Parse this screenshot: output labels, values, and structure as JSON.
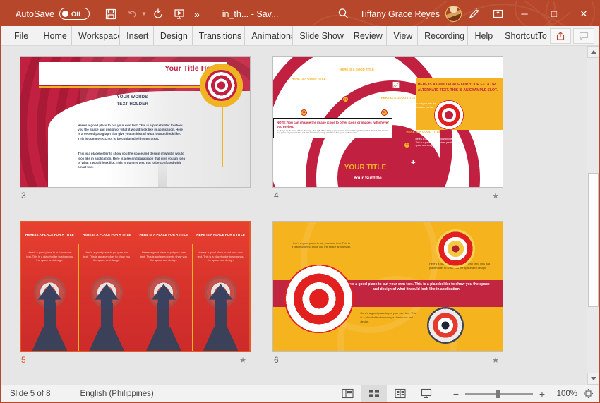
{
  "titlebar": {
    "autosave_label": "AutoSave",
    "autosave_state": "Off",
    "quick_access": [
      {
        "name": "save-button",
        "label": "Save"
      },
      {
        "name": "undo-button",
        "label": "Undo"
      },
      {
        "name": "redo-button",
        "label": "Redo"
      },
      {
        "name": "start-presentation-button",
        "label": "Start From Beginning"
      },
      {
        "name": "more-commands-button",
        "label": "»"
      }
    ],
    "document_title": "in_th...  -  Sav...",
    "search_placeholder": "Search",
    "user_name": "Tiffany Grace Reyes",
    "ribbon_display_label": "Ribbon Display Options",
    "minimize_label": "─",
    "maximize_label": "□",
    "close_label": "✕"
  },
  "ribbon": {
    "tabs": [
      {
        "label": "File"
      },
      {
        "label": "Home"
      },
      {
        "label": "Workspace"
      },
      {
        "label": "Insert"
      },
      {
        "label": "Design"
      },
      {
        "label": "Transitions"
      },
      {
        "label": "Animations"
      },
      {
        "label": "Slide Show"
      },
      {
        "label": "Review"
      },
      {
        "label": "View"
      },
      {
        "label": "Recording"
      },
      {
        "label": "Help"
      },
      {
        "label": "ShortcutTo"
      }
    ],
    "share_label": "Share",
    "comments_label": "Comments"
  },
  "slides": [
    {
      "number": "3",
      "has_animation_star": false,
      "selected": false,
      "title": "Your Title Here",
      "subtitle_line1": "YOUR WORDS",
      "subtitle_line2": "TEXT HOLDER",
      "paragraph1": "Here's a good place to put your own text. This is a placeholder to show you the space and design of what it would look like in application. Here is a second paragraph that give you an idea of what it would look like. This is dummy text, not to be confused with smart text.",
      "paragraph2": "This is a placeholder to show you the space and design of what it would look like in application. Here is a second paragraph that give you an idea of what it would look like. This is dummy text, not to be confused with smart text."
    },
    {
      "number": "4",
      "has_animation_star": true,
      "selected": false,
      "main_title": "YOUR TITLE",
      "subtitle": "Your Subtitle",
      "yellow_box_text": "HERE IS A GOOD PLACE FOR YOUR  EXTA OR ALTERNATE TEXT. THIS IS AN EXAMPLE SLOT.",
      "note_heading": "NOTE: You can change the image icons to other icons or images (whichever you prefer).",
      "note_body": "To change out the icons, click on the image, then right click to bring up popup menu. Choose \"Change Picture\" then \"From a File\". Locate your picture on your hard drive and click \"Insert\". Your image should now be in place of the last icon.",
      "steps": [
        {
          "badge": "01",
          "title": "HERE IS A GOOD TITLE",
          "text": "Here's a good place to put your own text. This is a placeholder to show you the space and design.",
          "icon": "gear-icon"
        },
        {
          "badge": "02",
          "title": "HERE IS A GOOD TITLE",
          "text": "Here's a good place to put your own text. This is a placeholder to show you the space and design.",
          "icon": "phone-icon"
        },
        {
          "badge": "03",
          "title": "HERE IS A GOOD TITLE",
          "text": "Here's a good place to put your own text. This is a placeholder to show you the space and design.",
          "icon": "chart-icon"
        },
        {
          "badge": "04",
          "title": "HERE IS A GOOD TITLE",
          "text": "Here's a good place to put your own text. This is a placeholder to show you the space and design.",
          "icon": "puzzle-icon"
        }
      ]
    },
    {
      "number": "5",
      "has_animation_star": true,
      "selected": true,
      "columns": [
        {
          "title": "HERE IS A PLACE FOR A TITLE",
          "text": "Here's a good place to put your own text. This is a placeholder to show you the space and design."
        },
        {
          "title": "HERE IS A PLACE FOR A TITLE",
          "text": "Here's a good place to put your own text. This is a placeholder to show you the space and design."
        },
        {
          "title": "HERE IS A PLACE FOR A TITLE",
          "text": "Here's a good place to put your own text. This is a placeholder to show you the space and design."
        },
        {
          "title": "HERE IS A PLACE FOR A TITLE",
          "text": "Here's a good place to put your own text. This is a placeholder to show you the space and design."
        }
      ]
    },
    {
      "number": "6",
      "has_animation_star": true,
      "selected": false,
      "band_text": "Here's a good place to put your own text. This is a placeholder to show you the space and design of what it would look like in application.",
      "text_top_left": "Here's a good place to put your own text. This is a placeholder to show you the space and design.",
      "text_right": "Here's a good place to put your own text. This is a placeholder to show you the space and design.",
      "text_bottom": "Here's a good place to put your own text. This is a placeholder to show you the space and design."
    }
  ],
  "status": {
    "slide_indicator": "Slide 5 of 8",
    "language": "English (Philippines)",
    "views": [
      {
        "name": "normal-view-button",
        "label": "Normal",
        "active": false
      },
      {
        "name": "slide-sorter-view-button",
        "label": "Slide Sorter",
        "active": true
      },
      {
        "name": "reading-view-button",
        "label": "Reading View",
        "active": false
      },
      {
        "name": "slideshow-view-button",
        "label": "Slide Show",
        "active": false
      }
    ],
    "zoom_out_label": "−",
    "zoom_in_label": "+",
    "zoom_value": "100%",
    "fit_label": "Fit slide to current window"
  },
  "colors": {
    "brand": "#b7472a",
    "accent_red": "#c22040",
    "accent_yellow": "#f5b323",
    "selected": "#e05a2b"
  }
}
